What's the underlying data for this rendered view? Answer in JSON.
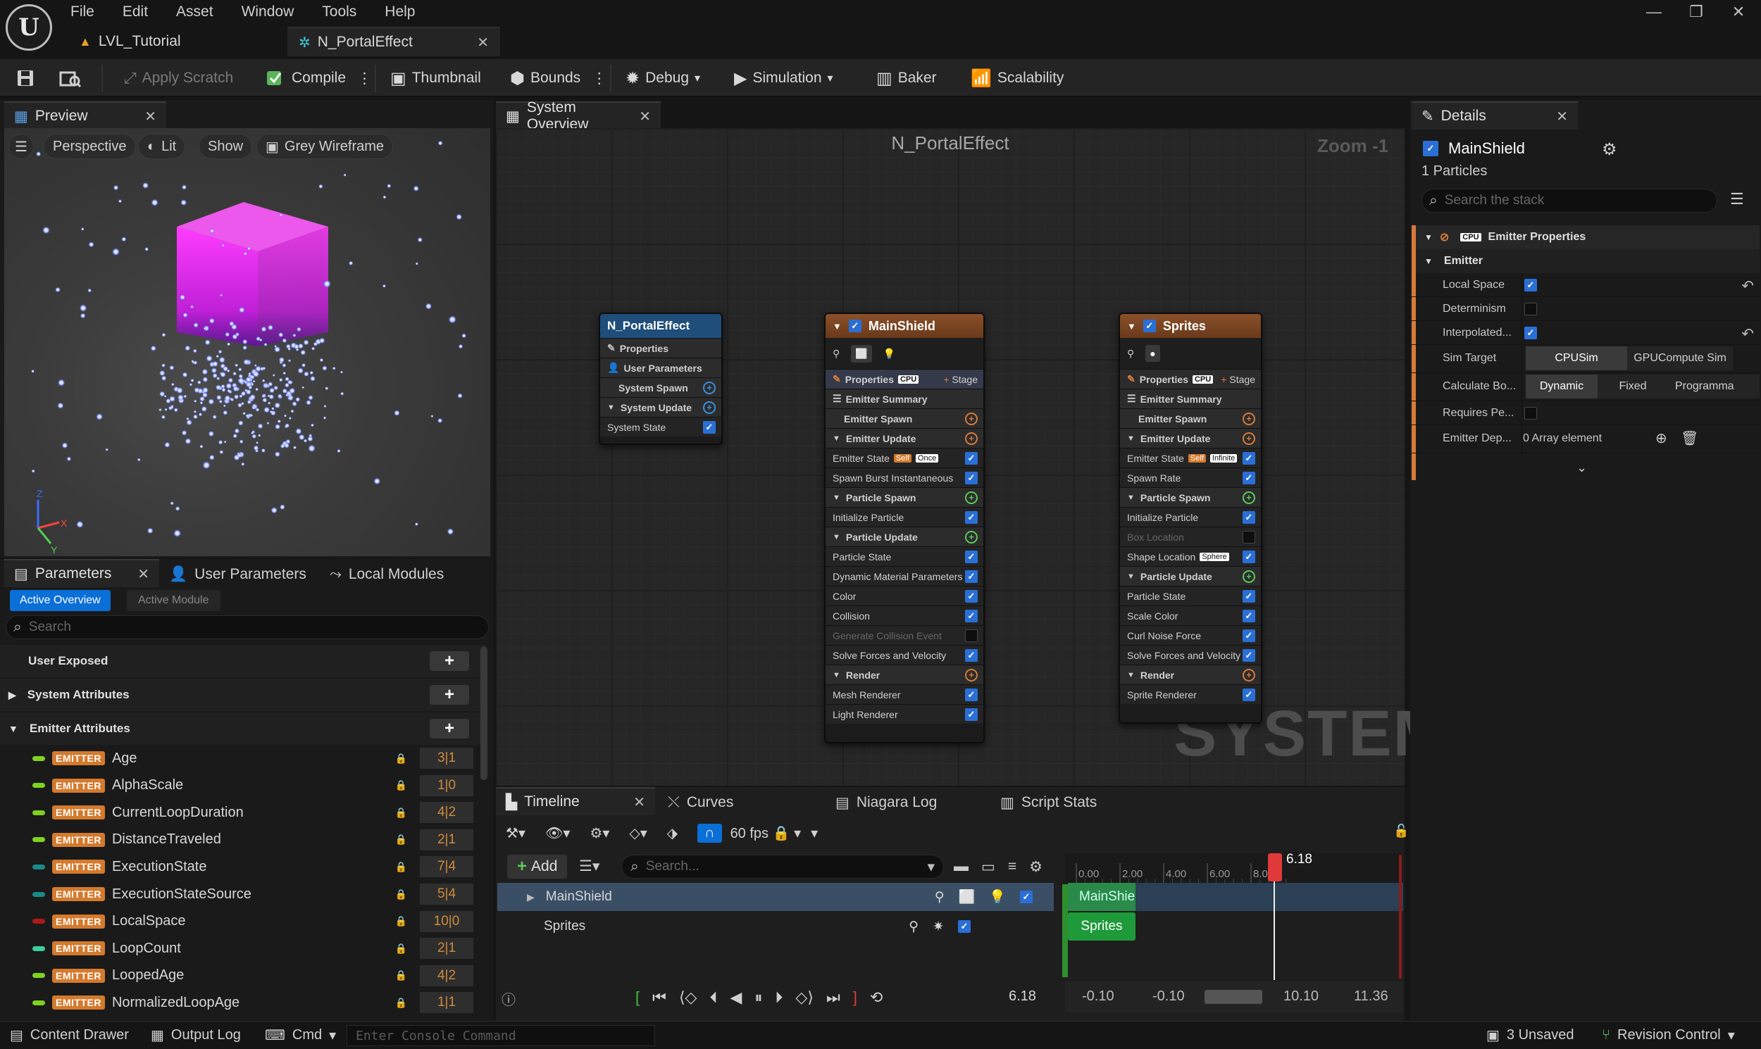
{
  "app": {
    "menu": [
      "File",
      "Edit",
      "Asset",
      "Window",
      "Tools",
      "Help"
    ],
    "tabs": [
      {
        "label": "LVL_Tutorial"
      },
      {
        "label": "N_PortalEffect"
      }
    ]
  },
  "toolbar": {
    "apply_scratch": "Apply Scratch",
    "compile": "Compile",
    "thumbnail": "Thumbnail",
    "bounds": "Bounds",
    "debug": "Debug",
    "simulation": "Simulation",
    "baker": "Baker",
    "scalability": "Scalability"
  },
  "preview": {
    "tab": "Preview",
    "perspective": "Perspective",
    "lit": "Lit",
    "show": "Show",
    "grey_wireframe": "Grey Wireframe"
  },
  "parameters": {
    "tabs": [
      "Parameters",
      "User Parameters",
      "Local Modules"
    ],
    "subtabs": [
      "Active Overview",
      "Active Module"
    ],
    "search_placeholder": "Search",
    "categories": [
      "User Exposed",
      "System Attributes",
      "Emitter Attributes"
    ],
    "badge": "EMITTER",
    "items": [
      {
        "name": "Age",
        "count": "3|1",
        "color": "#7ed321"
      },
      {
        "name": "AlphaScale",
        "count": "1|0",
        "color": "#7ed321"
      },
      {
        "name": "CurrentLoopDuration",
        "count": "4|2",
        "color": "#7ed321"
      },
      {
        "name": "DistanceTraveled",
        "count": "2|1",
        "color": "#7ed321"
      },
      {
        "name": "ExecutionState",
        "count": "7|4",
        "color": "#1a8a8a"
      },
      {
        "name": "ExecutionStateSource",
        "count": "5|4",
        "color": "#1a8a8a"
      },
      {
        "name": "LocalSpace",
        "count": "10|0",
        "color": "#b01818"
      },
      {
        "name": "LoopCount",
        "count": "2|1",
        "color": "#39d0a0"
      },
      {
        "name": "LoopedAge",
        "count": "4|2",
        "color": "#7ed321"
      },
      {
        "name": "NormalizedLoopAge",
        "count": "1|1",
        "color": "#7ed321"
      }
    ]
  },
  "graph": {
    "tab": "System Overview",
    "title": "N_PortalEffect",
    "zoom": "Zoom -1",
    "watermark": "SYSTEM",
    "system_node": {
      "title": "N_PortalEffect",
      "rows": [
        "Properties",
        "User Parameters",
        "System Spawn",
        "System Update",
        "System State"
      ]
    },
    "mainshield": {
      "title": "MainShield",
      "properties": "Properties",
      "cpu": "CPU",
      "stage": "Stage",
      "summary": "Emitter Summary",
      "rows": [
        {
          "label": "Emitter Spawn",
          "kind": "group-add"
        },
        {
          "label": "Emitter Update",
          "kind": "section"
        },
        {
          "label": "Emitter State",
          "kind": "check",
          "tags": [
            "Self",
            "Once"
          ]
        },
        {
          "label": "Spawn Burst Instantaneous",
          "kind": "check"
        },
        {
          "label": "Particle Spawn",
          "kind": "section-g"
        },
        {
          "label": "Initialize Particle",
          "kind": "check"
        },
        {
          "label": "Particle Update",
          "kind": "section-g"
        },
        {
          "label": "Particle State",
          "kind": "check"
        },
        {
          "label": "Dynamic Material Parameters",
          "kind": "check"
        },
        {
          "label": "Color",
          "kind": "check"
        },
        {
          "label": "Collision",
          "kind": "check"
        },
        {
          "label": "Generate Collision Event",
          "kind": "off"
        },
        {
          "label": "Solve Forces and Velocity",
          "kind": "check"
        },
        {
          "label": "Render",
          "kind": "section"
        },
        {
          "label": "Mesh Renderer",
          "kind": "check"
        },
        {
          "label": "Light Renderer",
          "kind": "check"
        }
      ]
    },
    "sprites": {
      "title": "Sprites",
      "properties": "Properties",
      "cpu": "CPU",
      "stage": "Stage",
      "summary": "Emitter Summary",
      "rows": [
        {
          "label": "Emitter Spawn",
          "kind": "group-add"
        },
        {
          "label": "Emitter Update",
          "kind": "section"
        },
        {
          "label": "Emitter State",
          "kind": "check",
          "tags": [
            "Self",
            "Infinite"
          ]
        },
        {
          "label": "Spawn Rate",
          "kind": "check"
        },
        {
          "label": "Particle Spawn",
          "kind": "section-g"
        },
        {
          "label": "Initialize Particle",
          "kind": "check"
        },
        {
          "label": "Box Location",
          "kind": "off"
        },
        {
          "label": "Shape Location",
          "kind": "check",
          "tags": [
            "Sphere"
          ]
        },
        {
          "label": "Particle Update",
          "kind": "section-g"
        },
        {
          "label": "Particle State",
          "kind": "check"
        },
        {
          "label": "Scale Color",
          "kind": "check"
        },
        {
          "label": "Curl Noise Force",
          "kind": "check"
        },
        {
          "label": "Solve Forces and Velocity",
          "kind": "check"
        },
        {
          "label": "Render",
          "kind": "section"
        },
        {
          "label": "Sprite Renderer",
          "kind": "check"
        }
      ]
    }
  },
  "timeline": {
    "tabs": [
      "Timeline",
      "Curves",
      "Niagara Log",
      "Script Stats"
    ],
    "fps": "60 fps",
    "add": "Add",
    "search_placeholder": "Search...",
    "tracks": [
      "MainShield",
      "Sprites"
    ],
    "ticks": [
      "0.00",
      "2.00",
      "4.00",
      "6.00",
      "8.00"
    ],
    "playhead": "6.18",
    "current_time": "6.18",
    "range": [
      "-0.10",
      "-0.10",
      "10.10",
      "11.36"
    ]
  },
  "details": {
    "tab": "Details",
    "emitter": "MainShield",
    "particles": "1 Particles",
    "search_placeholder": "Search the stack",
    "section": "Emitter Properties",
    "cpu": "CPU",
    "group": "Emitter",
    "rows": {
      "local_space": "Local Space",
      "determinism": "Determinism",
      "interpolated": "Interpolated...",
      "sim_target": "Sim Target",
      "calc_bounds": "Calculate Bo...",
      "requires": "Requires Pe...",
      "emitter_dep": "Emitter Dep..."
    },
    "sim_target_options": [
      "CPUSim",
      "GPUCompute Sim"
    ],
    "bounds_options": [
      "Dynamic",
      "Fixed",
      "Programma"
    ],
    "array_text": "0 Array element"
  },
  "statusbar": {
    "content_drawer": "Content Drawer",
    "output_log": "Output Log",
    "cmd": "Cmd",
    "console_placeholder": "Enter Console Command",
    "unsaved": "3 Unsaved",
    "revision": "Revision Control"
  }
}
